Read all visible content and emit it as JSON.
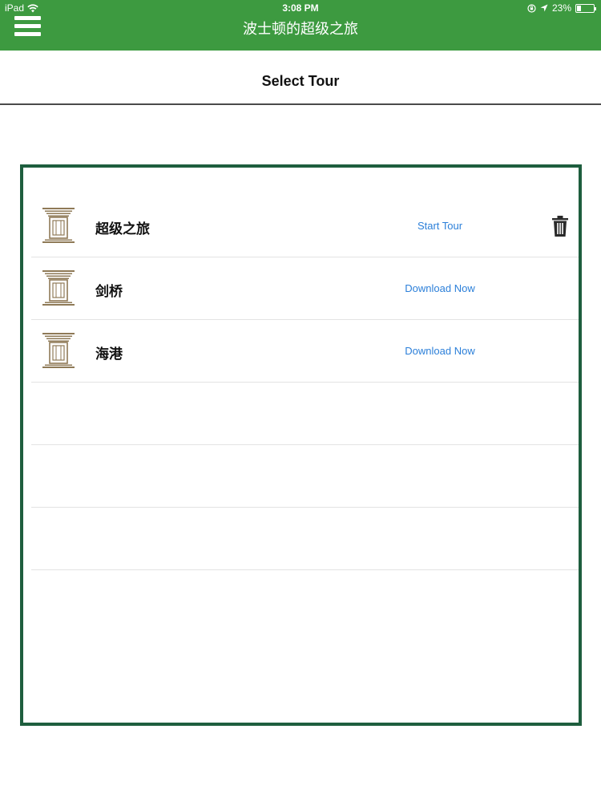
{
  "status_bar": {
    "device": "iPad",
    "time": "3:08 PM",
    "battery_percent": "23%",
    "battery_level": 0.23
  },
  "nav_bar": {
    "title": "波士顿的超级之旅",
    "menu_icon": "hamburger-menu-icon"
  },
  "subheader": {
    "title": "Select Tour"
  },
  "colors": {
    "nav_green": "#3d9a40",
    "panel_border": "#1e5e3e",
    "link_blue": "#2b7fd9"
  },
  "tours": [
    {
      "name": "超级之旅",
      "action": "Start Tour",
      "has_delete": true,
      "icon": "building-column-icon"
    },
    {
      "name": "剑桥",
      "action": "Download Now",
      "has_delete": false,
      "icon": "building-column-icon"
    },
    {
      "name": "海港",
      "action": "Download Now",
      "has_delete": false,
      "icon": "building-column-icon"
    }
  ]
}
